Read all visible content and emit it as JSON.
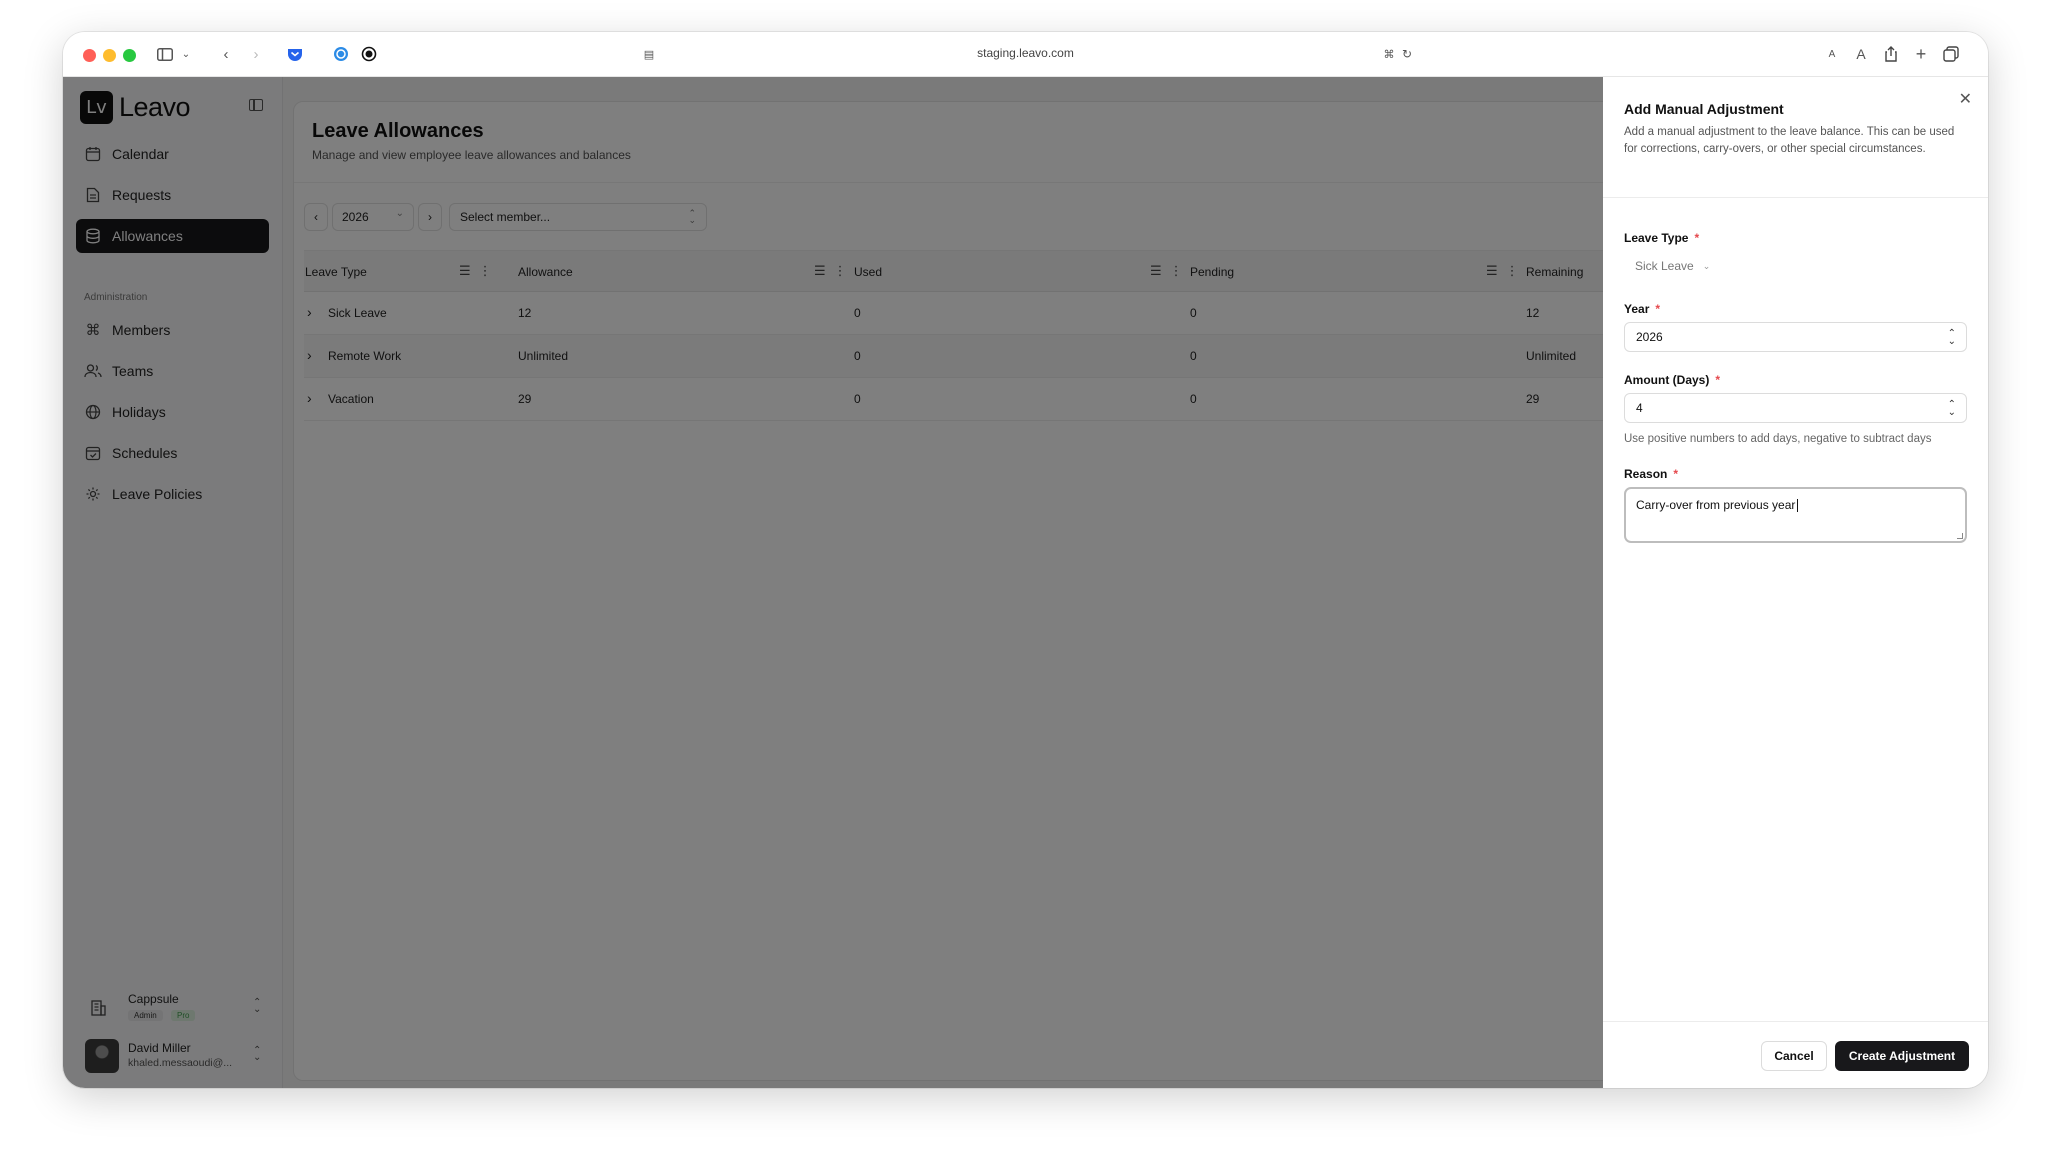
{
  "browser": {
    "url": "staging.leavo.com"
  },
  "brand": {
    "logo_mark": "Lv",
    "logo_text": "Leavo"
  },
  "sidebar": {
    "items": [
      {
        "label": "Calendar",
        "icon": "calendar-icon"
      },
      {
        "label": "Requests",
        "icon": "document-icon"
      },
      {
        "label": "Allowances",
        "icon": "database-icon",
        "active": true
      }
    ],
    "admin_label": "Administration",
    "admin_items": [
      {
        "label": "Members",
        "icon": "command-icon"
      },
      {
        "label": "Teams",
        "icon": "users-icon"
      },
      {
        "label": "Holidays",
        "icon": "globe-icon"
      },
      {
        "label": "Schedules",
        "icon": "calendar-check-icon"
      },
      {
        "label": "Leave Policies",
        "icon": "gear-icon"
      }
    ],
    "org": {
      "name": "Cappsule",
      "role_badge": "Admin",
      "plan_badge": "Pro"
    },
    "user": {
      "name": "David Miller",
      "email": "khaled.messaoudi@..."
    }
  },
  "main": {
    "title": "Leave Allowances",
    "subtitle": "Manage and view employee leave allowances and balances",
    "year": "2026",
    "member_placeholder": "Select member...",
    "columns": [
      "Leave Type",
      "Allowance",
      "Used",
      "Pending",
      "Remaining"
    ],
    "rows": [
      {
        "type": "Sick Leave",
        "allowance": "12",
        "used": "0",
        "pending": "0",
        "remaining": "12"
      },
      {
        "type": "Remote Work",
        "allowance": "Unlimited",
        "used": "0",
        "pending": "0",
        "remaining": "Unlimited"
      },
      {
        "type": "Vacation",
        "allowance": "29",
        "used": "0",
        "pending": "0",
        "remaining": "29"
      }
    ]
  },
  "drawer": {
    "title": "Add Manual Adjustment",
    "description": "Add a manual adjustment to the leave balance. This can be used for corrections, carry-overs, or other special circumstances.",
    "leave_type_label": "Leave Type",
    "leave_type_value": "Sick Leave",
    "year_label": "Year",
    "year_value": "2026",
    "amount_label": "Amount (Days)",
    "amount_value": "4",
    "amount_hint": "Use positive numbers to add days, negative to subtract days",
    "reason_label": "Reason",
    "reason_value": "Carry-over from previous year",
    "required_mark": "*",
    "cancel_label": "Cancel",
    "create_label": "Create Adjustment"
  },
  "colors": {
    "accent": "#18181b",
    "required": "#e5484d",
    "pro_badge": "#3f9d4b"
  }
}
